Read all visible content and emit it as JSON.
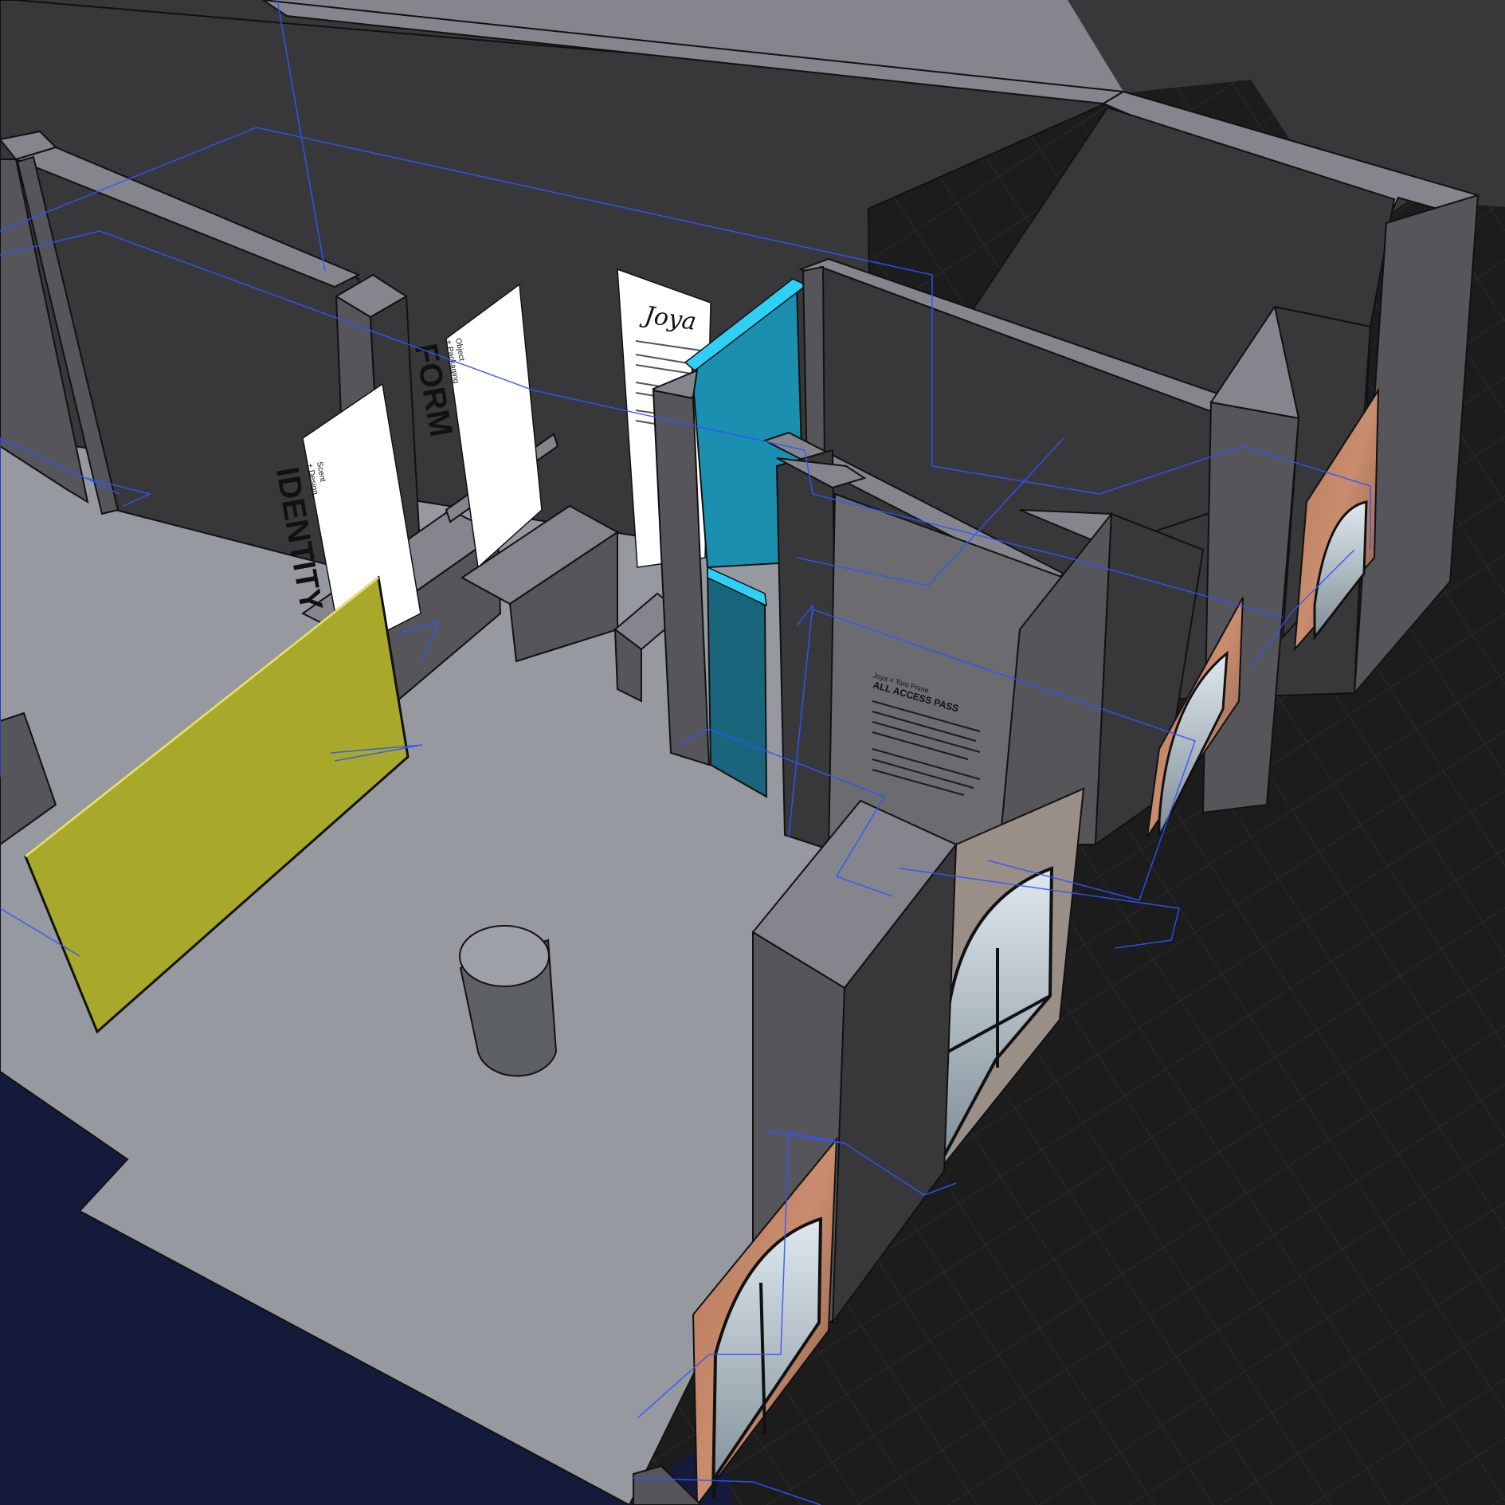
{
  "scene": {
    "background_color": "#1c1c1d",
    "grid_color": "#2a2a2c",
    "floor_color": "#969aa0",
    "wall_color": "#38383b",
    "pillar_color": "#55555a",
    "wall_top_color": "#7d7e85",
    "guide_color": "#2f55ff",
    "axis_color": "#c0392b"
  },
  "exhibits": {
    "identity_panel": {
      "subtitle_line1": "Scent",
      "subtitle_line2": "+ Design",
      "title": "IDENTITY"
    },
    "form_panel": {
      "subtitle_line1": "Object",
      "subtitle_line2": "+ Packaging",
      "title": "FORM"
    },
    "intro_panel": {
      "signature": "Joya"
    },
    "pass_panel": {
      "line1": "Joya × Toro Prime",
      "title": "ALL ACCESS PASS"
    },
    "yellow_panel_color": "#a8a82a",
    "blue_panel_color": "#1a8fb0",
    "blue_edge_color": "#2fd0f5"
  }
}
